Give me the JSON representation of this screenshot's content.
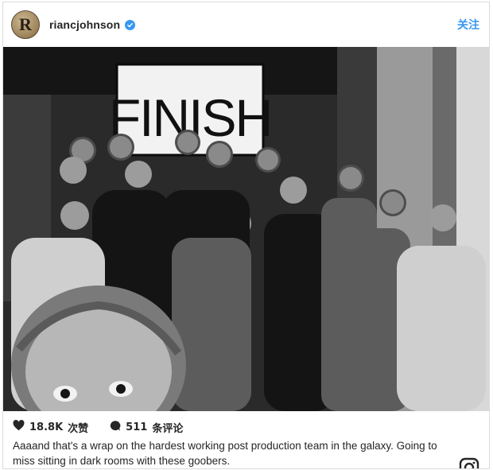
{
  "post": {
    "username": "riancjohnson",
    "avatar_letter": "R",
    "follow_label": "关注",
    "image": {
      "sign_text": "FINISH",
      "description_icon": "group-photo"
    },
    "likes_count": "18.8K",
    "likes_unit": "次赞",
    "comments_count": "511",
    "comments_unit": "条评论",
    "caption": "Aaaand that's a wrap on the hardest working post production team in the galaxy. Going to miss sitting in dark rooms with these goobers."
  },
  "colors": {
    "accent": "#3897f0",
    "text": "#262626",
    "border": "#dbdbdb"
  },
  "icons": [
    "verified-badge-icon",
    "heart-icon",
    "comment-bubble-icon",
    "instagram-logo-icon"
  ]
}
